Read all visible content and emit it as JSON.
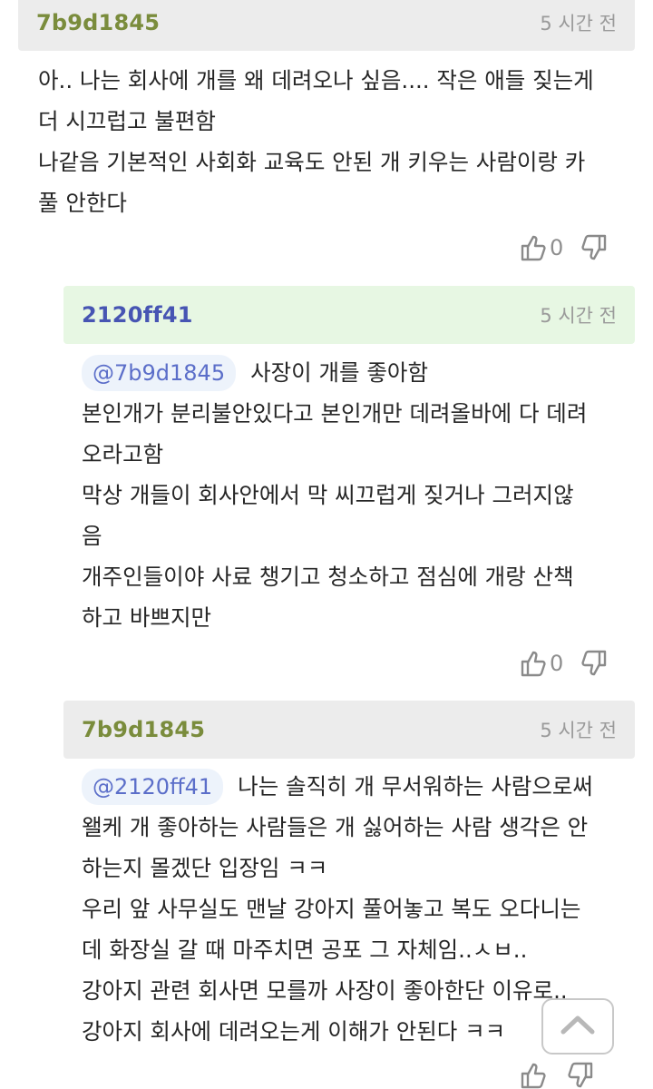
{
  "comments": [
    {
      "author": "7b9d1845",
      "time": "5 시간 전",
      "mention": "",
      "lines": [
        "아.. 나는 회사에 개를 왜 데려오나 싶음.... 작은 애들 짖는게",
        "더 시끄럽고 불편함",
        "나같음 기본적인 사회화 교육도 안된 개 키우는 사람이랑 카",
        "풀 안한다"
      ],
      "likes": "0"
    },
    {
      "author": "2120ff41",
      "time": "5 시간 전",
      "mention": "@7b9d1845",
      "lines": [
        "사장이 개를 좋아함",
        "본인개가 분리불안있다고 본인개만 데려올바에 다 데려",
        "오라고함",
        "막상 개들이 회사안에서 막 씨끄럽게 짖거나 그러지않",
        "음",
        "개주인들이야 사료 챙기고 청소하고 점심에 개랑 산책",
        "하고 바쁘지만"
      ],
      "likes": "0"
    },
    {
      "author": "7b9d1845",
      "time": "5 시간 전",
      "mention": "@2120ff41",
      "lines": [
        "나는 솔직히 개 무서워하는 사람으로써",
        "왤케 개 좋아하는 사람들은 개 싫어하는 사람 생각은 안",
        "하는지 몰겠단 입장임 ㅋㅋ",
        "우리 앞 사무실도 맨날 강아지 풀어놓고 복도 오다니는",
        "데 화장실 갈 때 마주치면 공포 그 자체임..ㅅㅂ..",
        "강아지 관련 회사면 모를까 사장이 좋아한단 이유로..",
        "강아지 회사에 데려오는게 이해가 안된다 ㅋㅋ"
      ],
      "likes": ""
    }
  ],
  "icons": {
    "like": "thumbs-up-icon",
    "dislike": "thumbs-down-icon",
    "scroll": "chevron-up-icon"
  },
  "colors": {
    "author_green": "#7a8c3c",
    "author_blue": "#4755b3",
    "header_gray": "#ececec",
    "header_green": "#e7f7e3",
    "mention_bg": "#edf3fb",
    "mention_text": "#5b6ec9"
  }
}
